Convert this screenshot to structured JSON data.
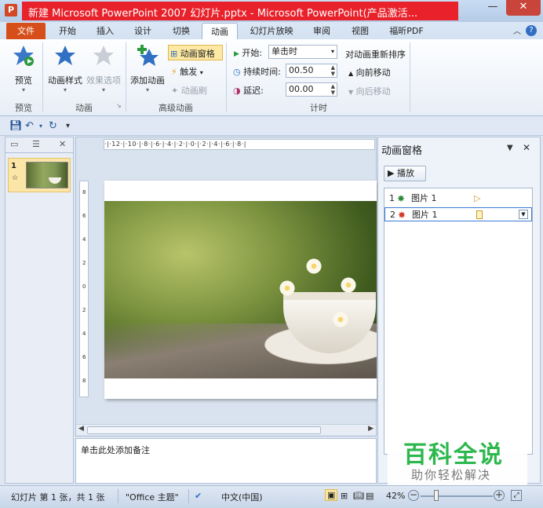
{
  "window": {
    "title": "新建 Microsoft PowerPoint 2007 幻灯片.pptx - Microsoft PowerPoint(产品激活...",
    "app_icon_letter": "P",
    "minimize": "—",
    "maximize": "☐",
    "close": "✕"
  },
  "tabs": [
    "文件",
    "开始",
    "插入",
    "设计",
    "切换",
    "动画",
    "幻灯片放映",
    "审阅",
    "视图",
    "福昕PDF"
  ],
  "active_tab": "动画",
  "ribbon": {
    "preview": {
      "button": "预览",
      "group": "预览"
    },
    "animation": {
      "style_button": "动画样式",
      "effect_button": "效果选项",
      "group": "动画"
    },
    "advanced": {
      "add_animation": "添加动画",
      "animation_pane": "动画窗格",
      "trigger": "触发",
      "painter": "动画刷",
      "group": "高级动画"
    },
    "timing": {
      "start_label": "开始:",
      "start_value": "单击时",
      "duration_label": "持续时间:",
      "duration_value": "00.50",
      "delay_label": "延迟:",
      "delay_value": "00.00",
      "reorder_title": "对动画重新排序",
      "move_earlier": "向前移动",
      "move_later": "向后移动",
      "group": "计时"
    }
  },
  "ruler": {
    "horizontal": "·|·12·|·10·|·8·|·6·|·4·|·2·|·0·|·2·|·4·|·6·|·8·|",
    "vertical": [
      "8",
      "6",
      "4",
      "2",
      "0",
      "2",
      "4",
      "6",
      "8"
    ]
  },
  "slides_panel": {
    "slide_number": "1",
    "star_mark": "☆"
  },
  "notes_placeholder": "单击此处添加备注",
  "animation_pane": {
    "title": "动画窗格",
    "play_button": "▶ 播放",
    "items": [
      {
        "num": "1",
        "name": "图片 1",
        "star_color": "#2e8b3a"
      },
      {
        "num": "2",
        "name": "图片 1",
        "star_color": "#d23a2a"
      }
    ]
  },
  "watermark": {
    "brand": "百科全说",
    "subtitle": "助你轻松解决"
  },
  "status": {
    "slide_info": "幻灯片 第 1 张，共 1 张",
    "theme": "\"Office 主题\"",
    "language": "中文(中国)",
    "zoom": "42%"
  },
  "colors": {
    "accent": "#2b579a",
    "file_tab": "#d64f1a",
    "title_red": "#e8212a",
    "watermark_green": "#2db84d"
  }
}
